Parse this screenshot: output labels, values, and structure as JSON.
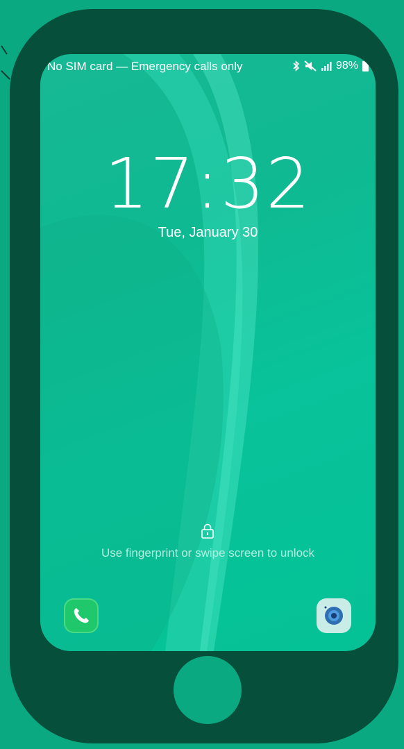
{
  "status_bar": {
    "carrier": "No SIM card — Emergency calls only",
    "battery": "98%",
    "icons": [
      "bluetooth-icon",
      "mute-icon",
      "signal-icon",
      "battery-icon"
    ]
  },
  "lock_screen": {
    "time": "17:32",
    "date": "Tue, January 30",
    "unlock_hint": "Use fingerprint or swipe screen to unlock"
  },
  "shortcuts": {
    "left": "phone-icon",
    "right": "camera-icon"
  },
  "colors": {
    "background": "#0aa982",
    "phone_frame": "#06503b",
    "screen_accent": "#08c39b"
  }
}
